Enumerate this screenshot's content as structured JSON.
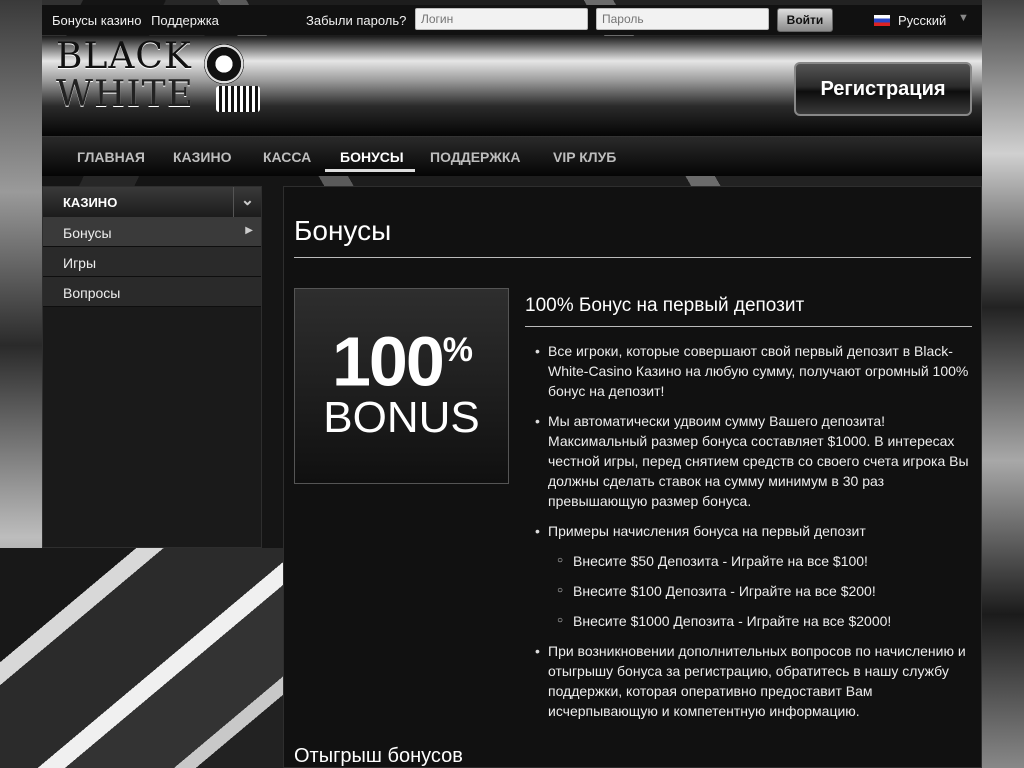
{
  "topbar": {
    "link_bonuses": "Бонусы казино",
    "link_support": "Поддержка",
    "forgot": "Забыли пароль?",
    "login_placeholder": "Логин",
    "password_placeholder": "Пароль",
    "login_button": "Войти",
    "language": "Русский",
    "language_flag_icon": "russia-flag-icon"
  },
  "header": {
    "logo_line1": "BLACK",
    "logo_line2": "WHITE",
    "register_button": "Регистрация"
  },
  "nav": {
    "items": [
      {
        "label": "ГЛАВНАЯ",
        "active": false
      },
      {
        "label": "КАЗИНО",
        "active": false
      },
      {
        "label": "КАССА",
        "active": false
      },
      {
        "label": "БОНУСЫ",
        "active": true
      },
      {
        "label": "ПОДДЕРЖКА",
        "active": false
      },
      {
        "label": "VIP КЛУБ",
        "active": false
      }
    ]
  },
  "sidebar": {
    "heading": "КАЗИНО",
    "items": [
      {
        "label": "Бонусы"
      },
      {
        "label": "Игры"
      },
      {
        "label": "Вопросы"
      }
    ]
  },
  "main": {
    "title": "Бонусы",
    "promo_image": {
      "line1": "100",
      "percent": "%",
      "line2": "BONUS"
    },
    "offer_title": "100% Бонус на первый депозит",
    "bullets": [
      "Все игроки, которые совершают свой первый депозит в Black-White-Casino Казино на любую сумму, получают огромный 100% бонус на депозит!",
      "Мы автоматически удвоим сумму Вашего депозита! Максимальный размер бонуса составляет $1000. В интересах честной игры, перед снятием средств со своего счета игрока Вы должны сделать ставок на сумму минимум в 30 раз превышающую размер бонуса.",
      "Примеры начисления бонуса на первый депозит"
    ],
    "examples": [
      "Внесите $50 Депозита - Играйте на все $100!",
      "Внесите $100 Депозита - Играйте на все $200!",
      "Внесите $1000 Депозита - Играйте на все $2000!"
    ],
    "last_bullet": "При возникновении дополнительных вопросов по начислению и отыгрышу бонуса за регистрацию, обратитесь в нашу службу поддержки, которая оперативно предоставит Вам исчерпывающую и компетентную информацию.",
    "subheading": "Отыгрыш бонусов"
  }
}
